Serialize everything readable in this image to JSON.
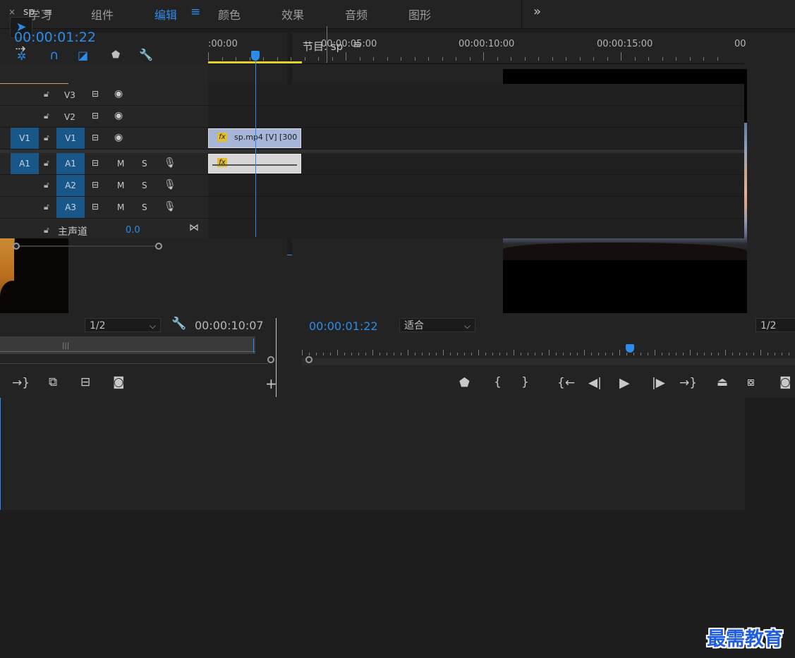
{
  "workspace": {
    "tabs": [
      "学习",
      "组件",
      "编辑",
      "颜色",
      "效果",
      "音频",
      "图形"
    ],
    "active_tab": "编辑",
    "menu_icon": "hamburger-icon",
    "more_icon": "double-chevron-right-icon"
  },
  "source_monitor": {
    "resolution": "1/2",
    "timecode": "00:00:10:07"
  },
  "program_monitor": {
    "title": "节目: sp",
    "timecode": "00:00:01:22",
    "fit": "适合",
    "resolution": "1/2"
  },
  "timeline": {
    "sequence_name": "sp",
    "timecode": "00:00:01:22",
    "ruler_labels": [
      ":00:00",
      "00:00:05:00",
      "00:00:10:00",
      "00:00:15:00",
      "00"
    ],
    "tracks": {
      "v3": "V3",
      "v2": "V2",
      "v1_source": "V1",
      "v1": "V1",
      "a1_source": "A1",
      "a1": "A1",
      "a2": "A2",
      "a3": "A3"
    },
    "mute_label": "M",
    "solo_label": "S",
    "video_clip_label": "sp.mp4 [V] [300",
    "fx_label": "fx",
    "master_label": "主声道",
    "master_value": "0.0"
  },
  "watermark": "最需教育",
  "colors": {
    "accent": "#2d8ceb",
    "workarea": "#e5d11f",
    "track_target": "#1a5789"
  }
}
